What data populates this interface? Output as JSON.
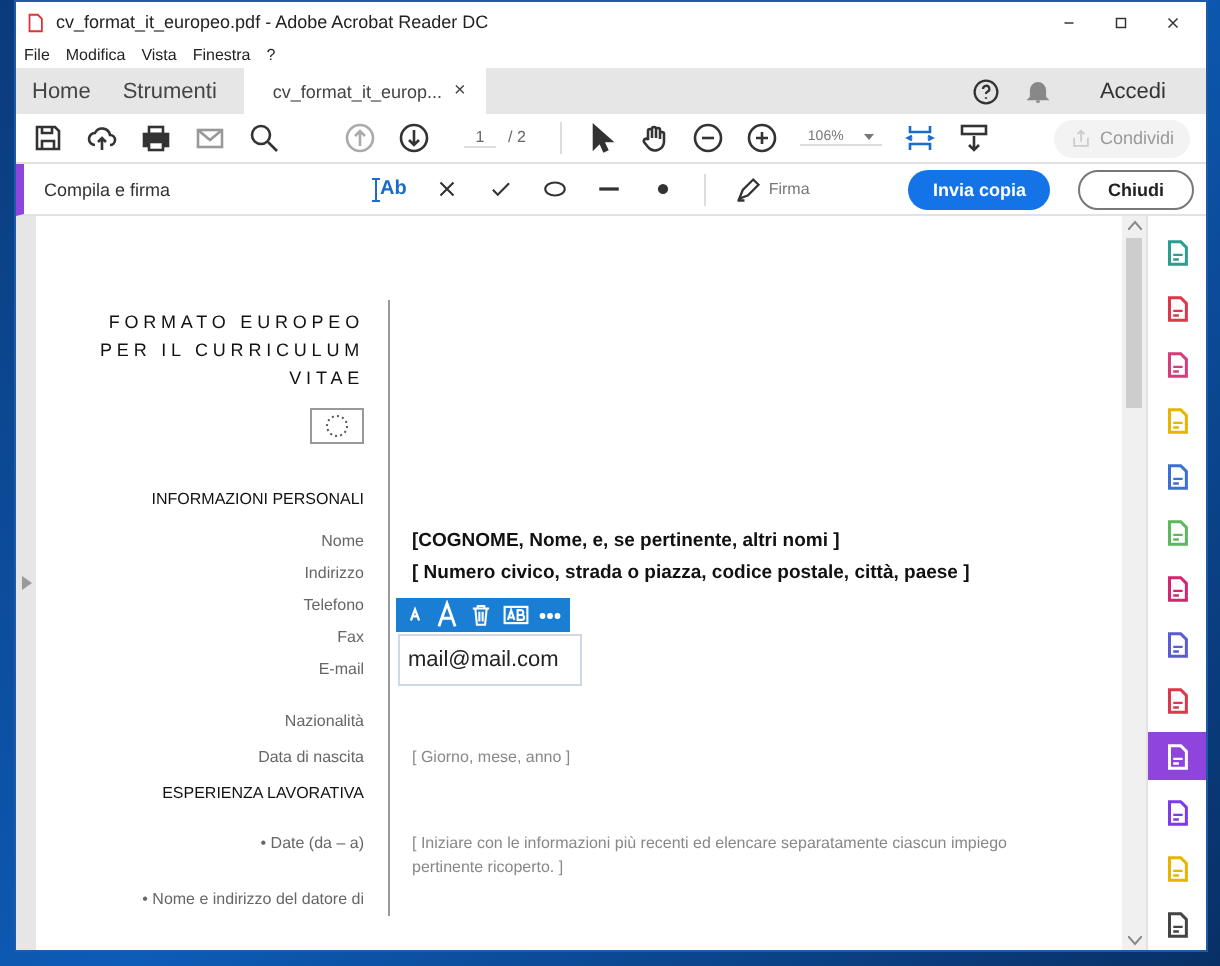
{
  "window": {
    "title": "cv_format_it_europeo.pdf - Adobe Acrobat Reader DC"
  },
  "menu": [
    "File",
    "Modifica",
    "Vista",
    "Finestra",
    "?"
  ],
  "tabs": [
    {
      "label": "Home",
      "kind": "nav",
      "selected": false
    },
    {
      "label": "Strumenti",
      "kind": "nav",
      "selected": false
    },
    {
      "label": "cv_format_it_europ...",
      "kind": "document",
      "selected": true,
      "close": "×"
    }
  ],
  "account": {
    "label": "Accedi"
  },
  "toolbar": {
    "page": "1",
    "pages": "/ 2",
    "zoom": "106%",
    "share": {
      "label": "Condividi",
      "disabled": true
    },
    "prev_disabled": true
  },
  "fill_sign": {
    "title": "Compila e firma",
    "text_tool": "Ab",
    "sign": "Firma",
    "send": "Invia copia",
    "close": "Chiudi"
  },
  "document": {
    "title_lines": [
      "FORMATO EUROPEO",
      "PER IL CURRICULUM",
      "VITAE"
    ],
    "rows": [
      {
        "kind": "section",
        "label": "INFORMAZIONI PERSONALI"
      },
      {
        "kind": "field",
        "label": "Nome",
        "value": "[COGNOME, Nome, e, se pertinente, altri nomi ]"
      },
      {
        "kind": "field",
        "label": "Indirizzo",
        "value": "[ Numero civico, strada o piazza, codice postale, città, paese ]"
      },
      {
        "kind": "field",
        "label": "Telefono"
      },
      {
        "kind": "field",
        "label": "Fax"
      },
      {
        "kind": "edit",
        "label": "E-mail",
        "value": "mail@mail.com"
      },
      {
        "kind": "spaced",
        "label": "Nazionalità"
      },
      {
        "kind": "note",
        "label": "Data di nascita",
        "value": "[ Giorno, mese, anno ]"
      },
      {
        "kind": "section",
        "label": "ESPERIENZA LAVORATIVA"
      },
      {
        "kind": "note",
        "label": "• Date (da – a)",
        "value": "[ Iniziare con le informazioni più recenti ed elencare separatamente ciascun impiego pertinente ricoperto. ]"
      },
      {
        "kind": "note",
        "label": "• Nome e indirizzo del datore di"
      }
    ]
  },
  "tools_panel": [
    {
      "color": "#2a9d8f",
      "selected": false
    },
    {
      "color": "#e0364a",
      "selected": false
    },
    {
      "color": "#d63b7a",
      "selected": false
    },
    {
      "color": "#e8b400",
      "selected": false
    },
    {
      "color": "#3a6fd8",
      "selected": false
    },
    {
      "color": "#5cb85c",
      "selected": false
    },
    {
      "color": "#d6246e",
      "selected": false
    },
    {
      "color": "#5b5bd6",
      "selected": false
    },
    {
      "color": "#e0364a",
      "selected": false
    },
    {
      "color": "#8e44dd",
      "selected": true
    },
    {
      "color": "#7c3aed",
      "selected": false
    },
    {
      "color": "#e8b400",
      "selected": false
    },
    {
      "color": "#444444",
      "selected": false
    }
  ]
}
